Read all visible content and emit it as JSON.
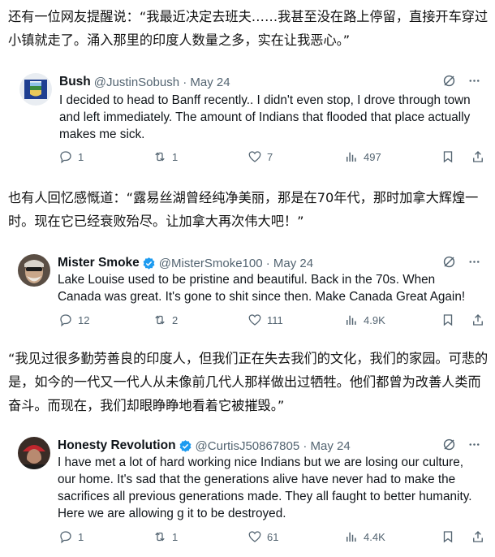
{
  "paragraphs": [
    "还有一位网友提醒说：“我最近决定去班夫……我甚至没在路上停留，直接开车穿过小镇就走了。涌入那里的印度人数量之多，实在让我恶心。”",
    "也有人回忆感慨道：“露易丝湖曾经纯净美丽，那是在70年代，那时加拿大辉煌一时。现在它已经衰败殆尽。让加拿大再次伟大吧！”",
    "“我见过很多勤劳善良的印度人，但我们正在失去我们的文化，我们的家园。可悲的是，如今的一代又一代人从未像前几代人那样做出过牺牲。他们都曾为改善人类而奋斗。而现在，我们却眼睁睁地看着它被摧毁。”"
  ],
  "tweets": [
    {
      "name": "Bush",
      "handle": "@JustinSobush · May 24",
      "verified": false,
      "text": "I decided to head to Banff recently.. I didn't even stop, I drove through town and left immediately. The amount of Indians that flooded that place actually makes me sick.",
      "replies": "1",
      "reposts": "1",
      "likes": "7",
      "views": "497"
    },
    {
      "name": "Mister Smoke",
      "handle": "@MisterSmoke100 · May 24",
      "verified": true,
      "text": "Lake Louise used to be pristine and beautiful. Back in the 70s. When Canada was great. It's gone to shit since then. Make Canada Great Again!",
      "replies": "12",
      "reposts": "2",
      "likes": "111",
      "views": "4.9K"
    },
    {
      "name": "Honesty Revolution",
      "handle": "@CurtisJ50867805 · May 24",
      "verified": true,
      "text": "I have met a lot of hard working nice Indians but we are losing our culture, our home. It's sad that the generations alive have never had to make the sacrifices all previous generations made. They all faught to better humanity. Here we are allowing g it to be destroyed.",
      "replies": "1",
      "reposts": "1",
      "likes": "61",
      "views": "4.4K"
    }
  ],
  "colors": {
    "text": "#0f1419",
    "muted": "#536471",
    "verified": "#1d9bf0"
  },
  "icons": [
    "grok-icon",
    "more-icon",
    "reply-icon",
    "repost-icon",
    "like-icon",
    "views-icon",
    "bookmark-icon",
    "share-icon",
    "verified-badge-icon"
  ]
}
